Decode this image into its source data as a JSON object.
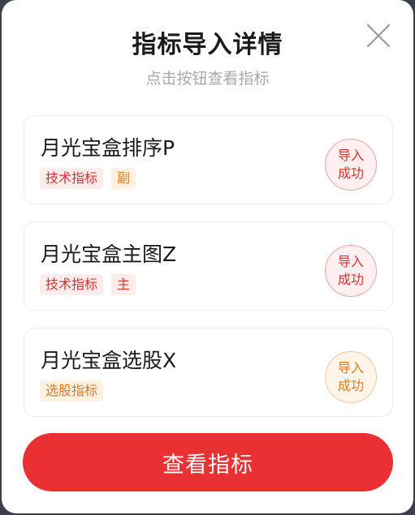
{
  "dialog": {
    "title": "指标导入详情",
    "subtitle": "点击按钮查看指标",
    "close_icon": "close-icon"
  },
  "cards": [
    {
      "name": "月光宝盒排序P",
      "tags": [
        "技术指标",
        "副"
      ],
      "status_line1": "导入",
      "status_line2": "成功",
      "status_color": "#d8302f"
    },
    {
      "name": "月光宝盒主图Z",
      "tags": [
        "技术指标",
        "主"
      ],
      "status_line1": "导入",
      "status_line2": "成功",
      "status_color": "#d8302f"
    },
    {
      "name": "月光宝盒选股X",
      "tags": [
        "选股指标"
      ],
      "status_line1": "导入",
      "status_line2": "成功",
      "status_color": "#e07a1c"
    }
  ],
  "footer": {
    "view_button_label": "查看指标",
    "button_color": "#e93033"
  }
}
